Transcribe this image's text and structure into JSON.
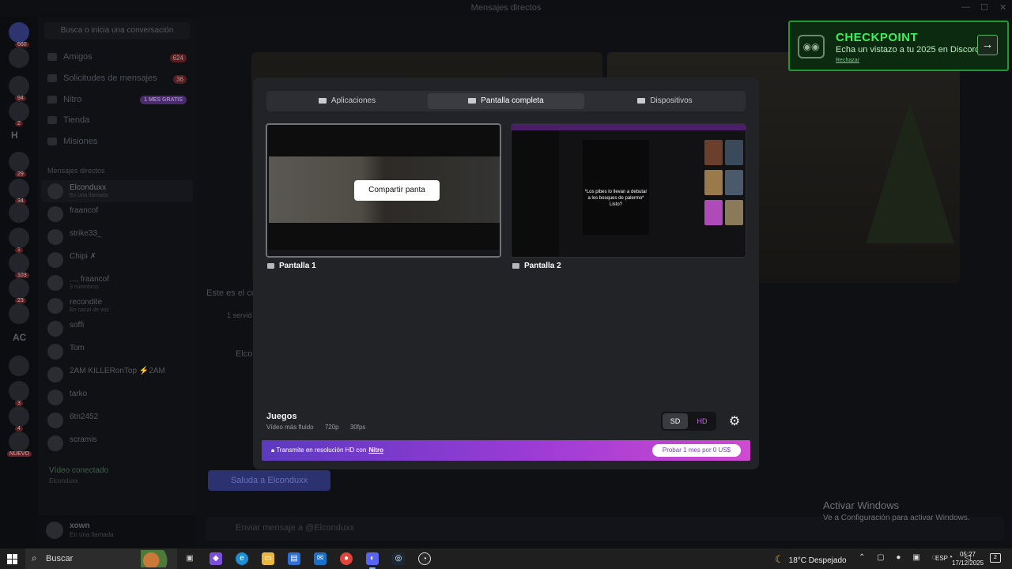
{
  "window": {
    "title": "Mensajes directos"
  },
  "dm_panel": {
    "search_placeholder": "Busca o inicia una conversación",
    "nav": [
      {
        "label": "Amigos",
        "count": "624"
      },
      {
        "label": "Solicitudes de mensajes",
        "count": "36"
      },
      {
        "label": "Nitro",
        "pill": "1 MES GRATIS"
      },
      {
        "label": "Tienda"
      },
      {
        "label": "Misiones"
      }
    ],
    "section_header": "Mensajes directos",
    "conversations": [
      {
        "name": "Elconduxx",
        "sub": "En una llamada"
      },
      {
        "name": "fraancof",
        "sub": ""
      },
      {
        "name": "strike33_",
        "sub": ""
      },
      {
        "name": "Chipi ✗",
        "sub": ""
      },
      {
        "name": "..., fraancof",
        "sub": "3 miembros"
      },
      {
        "name": "recondite",
        "sub": "En canal de voz"
      },
      {
        "name": "soffi",
        "sub": ""
      },
      {
        "name": "Tom",
        "sub": ""
      },
      {
        "name": "2AM KILLERonTop  ⚡2AM",
        "sub": ""
      },
      {
        "name": "tarko",
        "sub": ""
      },
      {
        "name": "6tn2452",
        "sub": ""
      },
      {
        "name": "scramis",
        "sub": ""
      }
    ],
    "voice": {
      "status": "Vídeo conectado",
      "channel": "Elconduxx"
    },
    "user": {
      "name": "xown",
      "status": "En una llamada"
    }
  },
  "servers": {
    "badges": [
      "660",
      "94",
      "2",
      "29",
      "34",
      "1",
      "103",
      "23",
      "3",
      "4"
    ],
    "labels": [
      "H",
      "AC"
    ],
    "new_tag": "NUEVO"
  },
  "background": {
    "call_text": "Este es el co",
    "servers_text": "1 servid",
    "call_name": "Elco",
    "greet_button": "Saluda a Elconduxx",
    "message_placeholder": "Enviar mensaje a @Elconduxx"
  },
  "toast": {
    "title": "CHECKPOINT",
    "subtitle": "Echa un vistazo a tu 2025 en Discord",
    "dismiss": "Rechazar",
    "arrow": "→"
  },
  "modal": {
    "tabs": [
      {
        "label": "Aplicaciones",
        "active": false
      },
      {
        "label": "Pantalla completa",
        "active": true
      },
      {
        "label": "Dispositivos",
        "active": false
      }
    ],
    "screens": [
      {
        "label": "Pantalla 1",
        "action": "Compartir panta"
      },
      {
        "label": "Pantalla 2",
        "caption": "*Los pibes lo llevan a debutar a los bosques de palermo* Listo?"
      }
    ],
    "preset": {
      "title": "Juegos",
      "desc": "Vídeo más fluido",
      "resolution": "720p",
      "fps": "30fps"
    },
    "quality": {
      "sd": "SD",
      "hd": "HD",
      "selected": "SD"
    },
    "nitro_banner": {
      "text": "Transmite en resolución HD con",
      "link": "Nitro",
      "cta": "Probar 1 mes por 0 US$"
    }
  },
  "windows_watermark": {
    "title": "Activar Windows",
    "subtitle": "Ve a Configuración para activar Windows."
  },
  "taskbar": {
    "search": "Buscar",
    "weather": "18°C  Despejado",
    "language": "ESP",
    "time": "05:27",
    "date": "17/12/2025",
    "notifications": "2"
  }
}
